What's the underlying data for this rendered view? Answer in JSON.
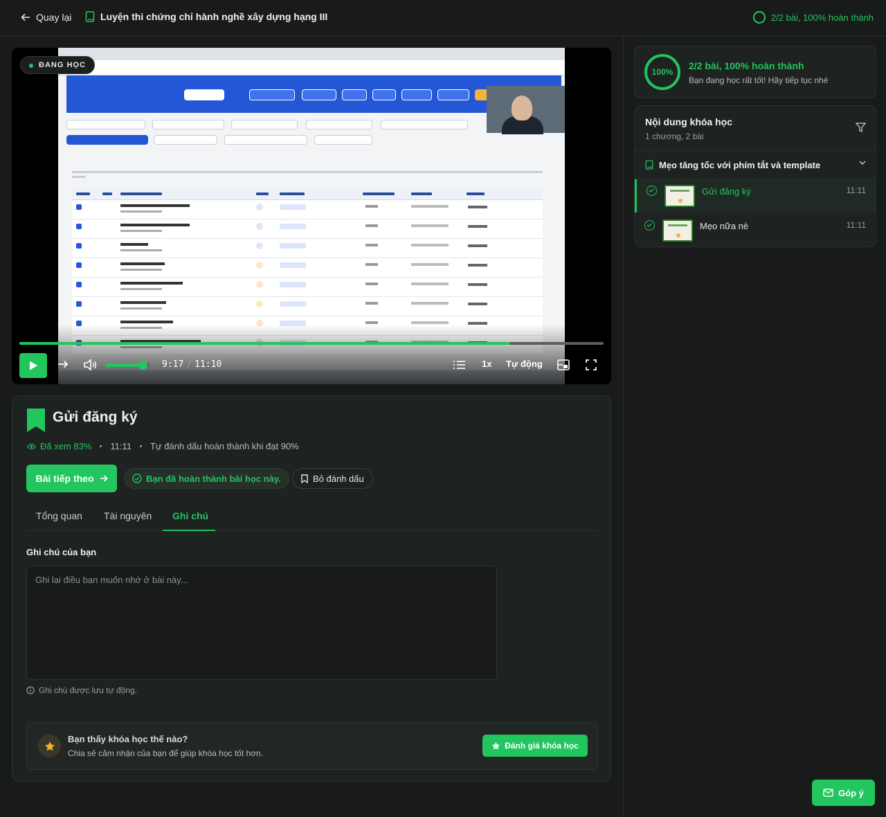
{
  "header": {
    "back_label": "Quay lại",
    "course_title": "Luyện thi chứng chỉ hành nghề xây dựng hạng III",
    "progress_text": "2/2 bài, 100% hoàn thành"
  },
  "sidebar": {
    "progress": {
      "percent_label": "100%",
      "title": "2/2 bài, 100% hoàn thành",
      "subtitle": "Bạn đang học rất tốt! Hãy tiếp tục nhé"
    },
    "content": {
      "title": "Nội dung khóa học",
      "subtitle": "1 chương, 2 bài",
      "chapter": "Mẹo tăng tốc với phím tắt và template",
      "lessons": [
        {
          "name": "Gửi đăng ký",
          "duration": "11:11",
          "completed": true,
          "active": true
        },
        {
          "name": "Mẹo nữa nè",
          "duration": "11:11",
          "completed": true,
          "active": false
        }
      ]
    }
  },
  "video": {
    "badge": "ĐANG HỌC",
    "current_time": "9:17",
    "total_time": "11:10",
    "progress": 0.84,
    "volume": 0.85,
    "speed": "1x",
    "quality": "Tự động"
  },
  "lesson": {
    "title": "Gửi đăng ký",
    "watched": "Đã xem 83%",
    "duration": "11:11",
    "auto_complete": "Tự đánh dấu hoàn thành khi đạt 90%",
    "next_button": "Bài tiếp theo",
    "done_label": "Bạn đã hoàn thành bài học này.",
    "unmark_label": "Bỏ đánh dấu",
    "tabs": [
      "Tổng quan",
      "Tài nguyên",
      "Ghi chú"
    ],
    "active_tab": "Ghi chú",
    "notes_label": "Ghi chú của bạn",
    "notes_placeholder": "Ghi lại điều bạn muốn nhớ ở bài này...",
    "autosave": "Ghi chú được lưu tự động.",
    "rate": {
      "title": "Bạn thấy khóa học thế nào?",
      "subtitle": "Chia sẻ cảm nhận của bạn để giúp khóa học tốt hơn.",
      "button": "Đánh giá khóa học"
    }
  },
  "feedback_label": "Góp ý",
  "colors": {
    "accent": "#22c55e",
    "background": "#181b1a",
    "card": "#1e2221"
  }
}
